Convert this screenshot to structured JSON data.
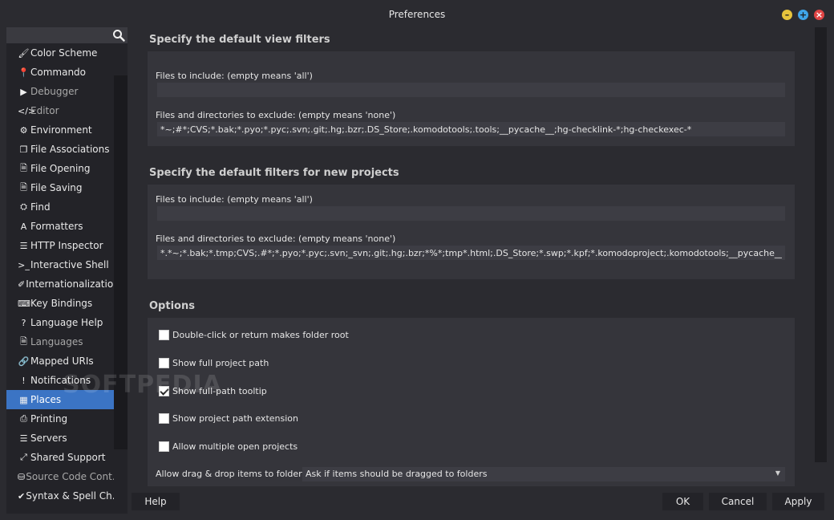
{
  "window": {
    "title": "Preferences"
  },
  "sidebar": {
    "items": [
      {
        "label": "Color Scheme",
        "icon": "brush-icon",
        "glyph": "🖌",
        "dim": false
      },
      {
        "label": "Commando",
        "icon": "pin-icon",
        "glyph": "📍",
        "dim": false
      },
      {
        "label": "Debugger",
        "icon": "play-icon",
        "glyph": "▶",
        "dim": true
      },
      {
        "label": "Editor",
        "icon": "code-icon",
        "glyph": "</>",
        "dim": true
      },
      {
        "label": "Environment",
        "icon": "gear-icon",
        "glyph": "⚙",
        "dim": false
      },
      {
        "label": "File Associations",
        "icon": "files-icon",
        "glyph": "❐",
        "dim": false
      },
      {
        "label": "File Opening",
        "icon": "file-icon",
        "glyph": "🗎",
        "dim": false
      },
      {
        "label": "File Saving",
        "icon": "file-save-icon",
        "glyph": "🗎",
        "dim": false
      },
      {
        "label": "Find",
        "icon": "binoculars-icon",
        "glyph": "⛭",
        "dim": false
      },
      {
        "label": "Formatters",
        "icon": "font-icon",
        "glyph": "A",
        "dim": false
      },
      {
        "label": "HTTP Inspector",
        "icon": "inspector-icon",
        "glyph": "☰",
        "dim": false
      },
      {
        "label": "Interactive Shell",
        "icon": "terminal-icon",
        "glyph": ">_",
        "dim": false
      },
      {
        "label": "Internationalization",
        "icon": "language-icon",
        "glyph": "✐",
        "dim": false
      },
      {
        "label": "Key Bindings",
        "icon": "keyboard-icon",
        "glyph": "⌨",
        "dim": false
      },
      {
        "label": "Language Help",
        "icon": "help-icon",
        "glyph": "?",
        "dim": false
      },
      {
        "label": "Languages",
        "icon": "languages-icon",
        "glyph": "🗎",
        "dim": true
      },
      {
        "label": "Mapped URIs",
        "icon": "link-icon",
        "glyph": "🔗",
        "dim": false
      },
      {
        "label": "Notifications",
        "icon": "notification-icon",
        "glyph": "!",
        "dim": false
      },
      {
        "label": "Places",
        "icon": "folder-icon",
        "glyph": "▦",
        "dim": false,
        "selected": true
      },
      {
        "label": "Printing",
        "icon": "printer-icon",
        "glyph": "⎙",
        "dim": false
      },
      {
        "label": "Servers",
        "icon": "server-icon",
        "glyph": "☰",
        "dim": false
      },
      {
        "label": "Shared Support",
        "icon": "share-icon",
        "glyph": "⤢",
        "dim": false
      },
      {
        "label": "Source Code Cont...",
        "icon": "database-icon",
        "glyph": "⛁",
        "dim": true
      },
      {
        "label": "Syntax & Spell Ch...",
        "icon": "check-circle-icon",
        "glyph": "✔",
        "dim": false
      }
    ]
  },
  "view_filters": {
    "title": "Specify the default view filters",
    "include_label": "Files to include: (empty means 'all')",
    "include_value": "",
    "exclude_label": "Files and directories to exclude: (empty means 'none')",
    "exclude_value": "*~;#*;CVS;*.bak;*.pyo;*.pyc;.svn;.git;.hg;.bzr;.DS_Store;.komodotools;.tools;__pycache__;hg-checklink-*;hg-checkexec-*"
  },
  "project_filters": {
    "title": "Specify the default filters for new projects",
    "include_label": "Files to include: (empty means 'all')",
    "include_value": "",
    "exclude_label": "Files and directories to exclude: (empty means 'none')",
    "exclude_value": "*.*~;*.bak;*.tmp;CVS;.#*;*.pyo;*.pyc;.svn;_svn;.git;.hg;.bzr;*%*;tmp*.html;.DS_Store;*.swp;*.kpf;*.komodoproject;.komodotools;__pycache__"
  },
  "options": {
    "title": "Options",
    "checkboxes": [
      {
        "label": "Double-click or return makes folder root",
        "checked": false
      },
      {
        "label": "Show full project path",
        "checked": false
      },
      {
        "label": "Show full-path tooltip",
        "checked": true
      },
      {
        "label": "Show project path extension",
        "checked": false
      },
      {
        "label": "Allow multiple open projects",
        "checked": false
      }
    ],
    "drag_label": "Allow drag & drop items to folders",
    "drag_value": "Ask if items should be dragged to folders"
  },
  "footer": {
    "help": "Help",
    "ok": "OK",
    "cancel": "Cancel",
    "apply": "Apply"
  },
  "watermark": "SOFTPEDIA",
  "colors": {
    "accent": "#3b74c4",
    "background": "#2b2b30",
    "panel": "#35353b"
  }
}
